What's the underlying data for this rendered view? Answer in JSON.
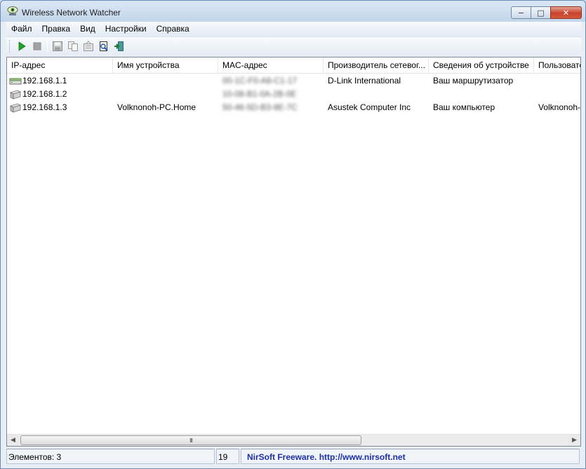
{
  "window": {
    "title": "Wireless Network Watcher",
    "icon": "eye-network-icon"
  },
  "caption_buttons": {
    "minimize": "−",
    "maximize": "□",
    "close": "✕"
  },
  "menu": [
    "Файл",
    "Правка",
    "Вид",
    "Настройки",
    "Справка"
  ],
  "toolbar": {
    "buttons": [
      "play-icon",
      "stop-icon",
      "save-icon",
      "copy-icon",
      "properties-icon",
      "html-report-icon",
      "exit-icon"
    ]
  },
  "table": {
    "columns": [
      "IP-адрес",
      "Имя устройства",
      "MAC-адрес",
      "Производитель сетевог...",
      "Сведения об устройстве",
      "Пользовате"
    ],
    "rows": [
      {
        "ip": "192.168.1.1",
        "icon": "router-icon",
        "name": "",
        "mac": "00-1C-F0-A8-C1-17",
        "vendor": "D-Link International",
        "info": "Ваш маршрутизатор",
        "user": ""
      },
      {
        "ip": "192.168.1.2",
        "icon": "computer-icon",
        "name": "",
        "mac": "10-08-B1-0A-2B-0E",
        "vendor": "",
        "info": "",
        "user": ""
      },
      {
        "ip": "192.168.1.3",
        "icon": "computer-icon",
        "name": "Volknonoh-PC.Home",
        "mac": "50-46-5D-B3-8E-7C",
        "vendor": "Asustek Computer Inc",
        "info": "Ваш компьютер",
        "user": "Volknonoh-"
      }
    ]
  },
  "scrollbar": {
    "thumb_grip": "III"
  },
  "status": {
    "items": "Элементов: 3",
    "count": "19",
    "link": "NirSoft Freeware.  http://www.nirsoft.net"
  }
}
